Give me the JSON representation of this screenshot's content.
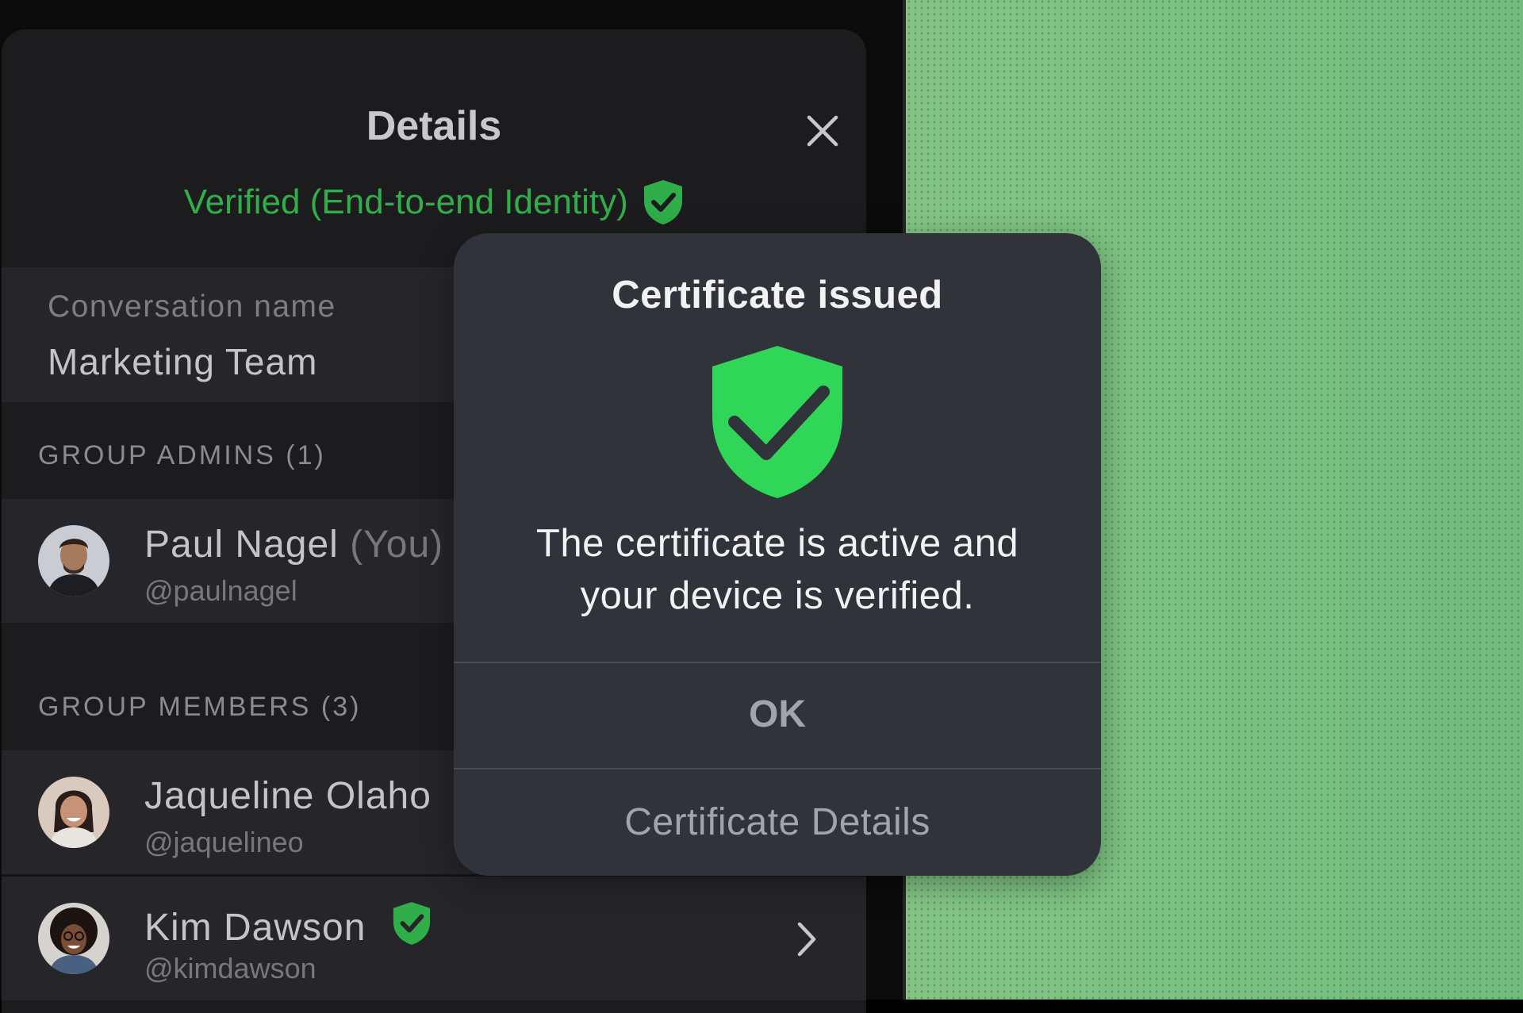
{
  "header": {
    "title": "Details",
    "verified_text": "Verified (End-to-end Identity)"
  },
  "conversation": {
    "label": "Conversation name",
    "value": "Marketing Team"
  },
  "admins": {
    "header": "GROUP ADMINS (1)",
    "items": [
      {
        "name": "Paul Nagel",
        "suffix": "(You)",
        "handle": "@paulnagel"
      }
    ]
  },
  "members": {
    "header": "GROUP MEMBERS (3)",
    "items": [
      {
        "name": "Jaqueline Olaho",
        "handle": "@jaquelineo"
      },
      {
        "name": "Kim Dawson",
        "handle": "@kimdawson",
        "verified": true
      }
    ]
  },
  "dialog": {
    "title": "Certificate issued",
    "message_line1": "The certificate is active and",
    "message_line2": "your device is verified.",
    "ok_label": "OK",
    "details_label": "Certificate Details"
  },
  "colors": {
    "verified_green": "#2fae4a",
    "shield_green": "#2fd657",
    "dialog_bg": "#31333a",
    "panel_bg": "#1c1c1f"
  },
  "icons": [
    "close-icon",
    "verified-shield-icon",
    "shield-check-icon",
    "chevron-right-icon"
  ]
}
